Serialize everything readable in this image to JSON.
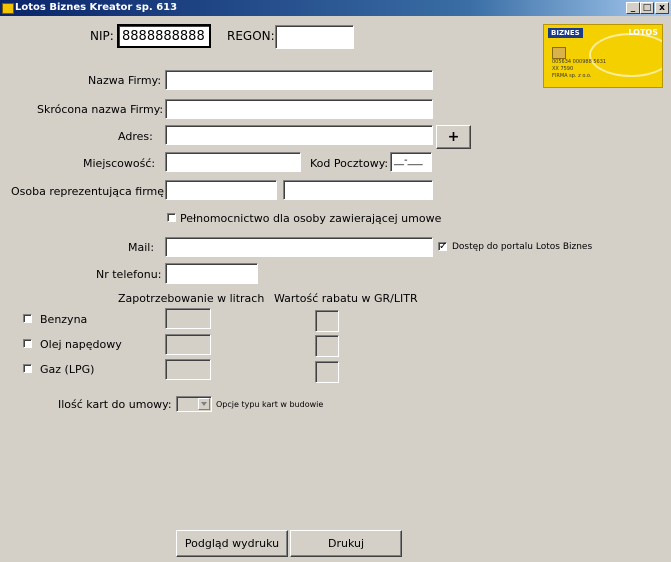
{
  "window": {
    "title": "Lotos Biznes Kreator sp. 613",
    "min": "_",
    "max": "□",
    "close": "x"
  },
  "card": {
    "brand": "BIZNES",
    "logo": "LOTOS",
    "line1": "005634 000988 5631",
    "line2": "XX 7590",
    "line3": "FIRMA sp. z o.o."
  },
  "nip": {
    "label": "NIP:",
    "value": "8888888888"
  },
  "regon": {
    "label": "REGON:",
    "value": ""
  },
  "fields": {
    "nazwa": "Nazwa Firmy:",
    "skrocona": "Skrócona nazwa Firmy:",
    "adres": "Adres:",
    "miejscowosc": "Miejscowość:",
    "kod": "Kod Pocztowy:",
    "kod_value": "__-___",
    "osoba": "Osoba reprezentująca firmę:",
    "mail": "Mail:",
    "telefon": "Nr telefonu:"
  },
  "plus_button": "+",
  "pelnomocnictwo": "Pełnomocnictwo dla osoby zawierającej umowe",
  "portal": {
    "label": "Dostęp do portalu Lotos Biznes",
    "checked": "✓"
  },
  "columns": {
    "litry": "Zapotrzebowanie w litrach",
    "rabat": "Wartość rabatu w GR/LITR"
  },
  "fuels": [
    "Benzyna",
    "Olej napędowy",
    "Gaz (LPG)"
  ],
  "karty": {
    "label": "Ilość kart do umowy:",
    "note": "Opcje typu kart w budowie"
  },
  "buttons": {
    "preview": "Podgląd wydruku",
    "print": "Drukuj"
  }
}
